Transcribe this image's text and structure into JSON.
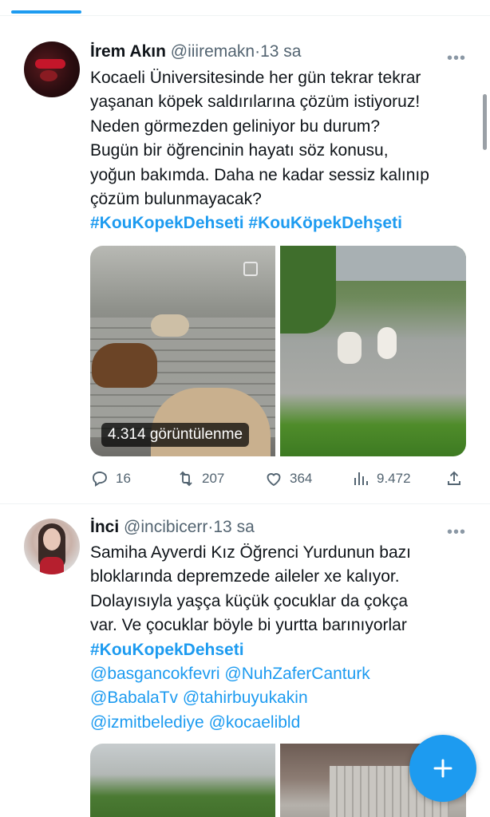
{
  "tabs": {
    "active_index": 0
  },
  "tweets": [
    {
      "author_name": "İrem Akın",
      "handle": "@iiiremakn",
      "separator": "·",
      "time": "13 sa",
      "more_icon": "more-dots-icon",
      "text_lines": [
        "Kocaeli Üniversitesinde her gün tekrar tekrar",
        "yaşanan köpek saldırılarına çözüm istiyoruz!",
        "Neden görmezden geliniyor bu durum?",
        "Bugün bir öğrencinin hayatı söz konusu,",
        "yoğun bakımda. Daha ne kadar sessiz kalınıp",
        "çözüm bulunmayacak?"
      ],
      "hashtags": [
        "#KouKopekDehseti",
        "#KouKöpekDehşeti"
      ],
      "views_label": "4.314 görüntülenme",
      "replies": "16",
      "retweets": "207",
      "likes": "364",
      "views": "9.472"
    },
    {
      "author_name": "İnci",
      "handle": "@incibicerr",
      "separator": "·",
      "time": "13 sa",
      "more_icon": "more-dots-icon",
      "text_lines": [
        "Samiha Ayverdi Kız Öğrenci Yurdunun bazı",
        "bloklarında depremzede aileler xe kalıyor.",
        "Dolayısıyla yaşça küçük çocuklar da çokça",
        "var. Ve çocuklar böyle bi yurtta barınıyorlar"
      ],
      "hashtag": "#KouKopekDehseti",
      "mentions": [
        [
          "@basgancokfevri",
          "@NuhZaferCanturk"
        ],
        [
          "@BabalaTv",
          "@tahirbuyukakin"
        ],
        [
          "@izmitbelediye",
          "@kocaelibld"
        ]
      ]
    }
  ],
  "fab": {
    "icon": "plus-icon"
  },
  "colors": {
    "accent": "#1d9bf0",
    "text": "#0f1419",
    "muted": "#536471"
  }
}
